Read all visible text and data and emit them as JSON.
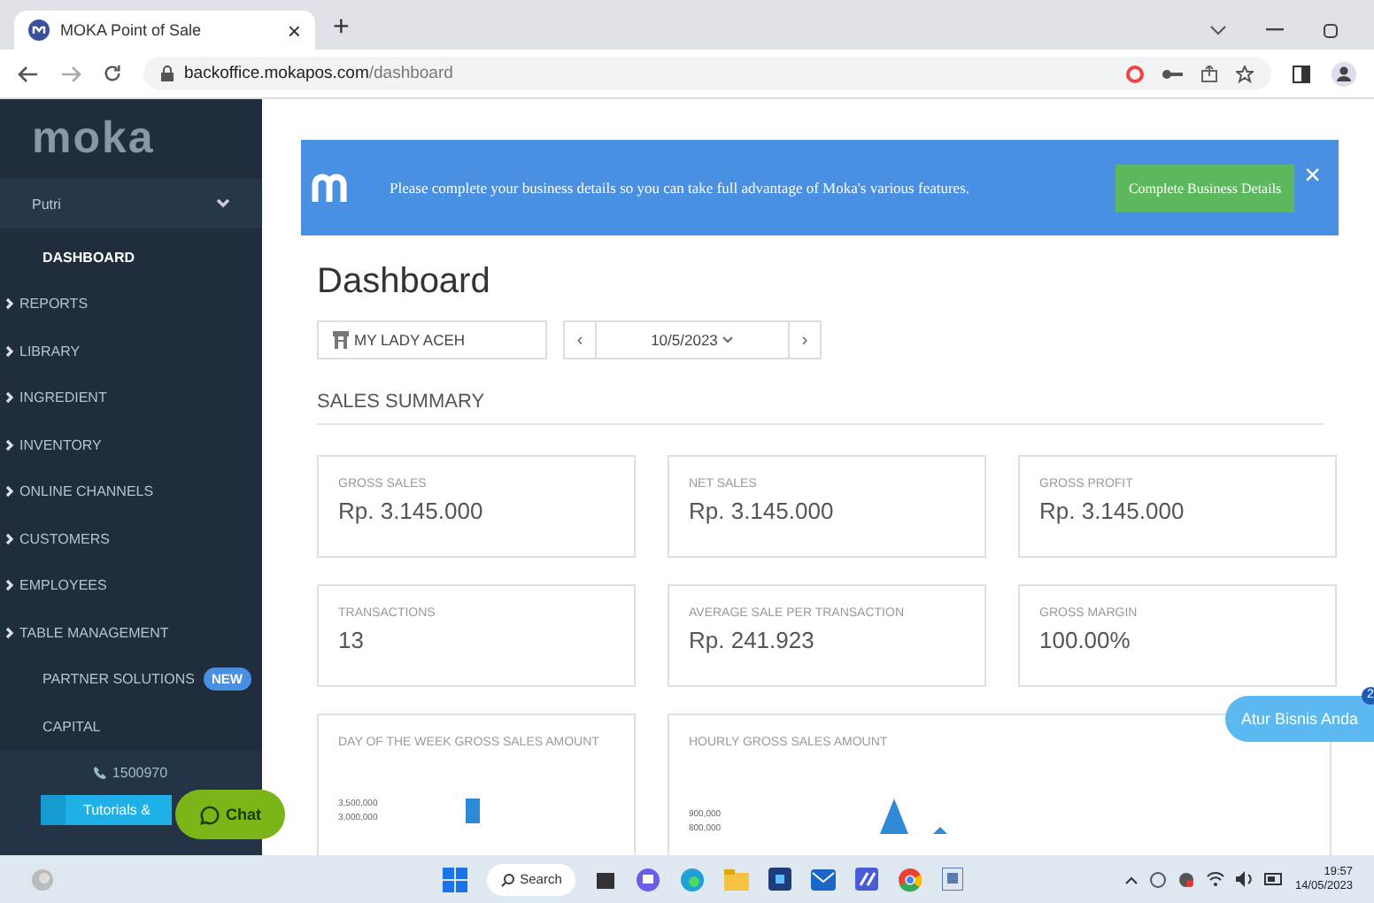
{
  "browser": {
    "tab_title": "MOKA Point of Sale",
    "tab_close": "×",
    "new_tab": "+",
    "url_host": "backoffice.mokapos.com",
    "url_path": "/dashboard"
  },
  "sidebar": {
    "logo": "moka",
    "user": "Putri",
    "items": [
      {
        "label": "DASHBOARD",
        "selected": true,
        "expandable": false
      },
      {
        "label": "REPORTS",
        "selected": false,
        "expandable": true
      },
      {
        "label": "LIBRARY",
        "selected": false,
        "expandable": true
      },
      {
        "label": "INGREDIENT",
        "selected": false,
        "expandable": true
      },
      {
        "label": "INVENTORY",
        "selected": false,
        "expandable": true
      },
      {
        "label": "ONLINE CHANNELS",
        "selected": false,
        "expandable": true
      },
      {
        "label": "CUSTOMERS",
        "selected": false,
        "expandable": true
      },
      {
        "label": "EMPLOYEES",
        "selected": false,
        "expandable": true
      },
      {
        "label": "TABLE MANAGEMENT",
        "selected": false,
        "expandable": true
      },
      {
        "label": "PARTNER SOLUTIONS",
        "selected": false,
        "expandable": false,
        "badge": "NEW"
      },
      {
        "label": "CAPITAL",
        "selected": false,
        "expandable": false
      }
    ],
    "phone": "1500970",
    "tutorials": "Tutorials &"
  },
  "chat_button": "Chat",
  "banner": {
    "message": "Please complete your business details so you can take full advantage of Moka's various features.",
    "button": "Complete Business Details",
    "close": "×"
  },
  "page_title": "Dashboard",
  "outlet": "MY LADY ACEH",
  "date": "10/5/2023",
  "prev": "‹",
  "next": "›",
  "section": "SALES SUMMARY",
  "cards": [
    {
      "label": "GROSS SALES",
      "value": "Rp. 3.145.000"
    },
    {
      "label": "NET SALES",
      "value": "Rp. 3.145.000"
    },
    {
      "label": "GROSS PROFIT",
      "value": "Rp. 3.145.000"
    },
    {
      "label": "TRANSACTIONS",
      "value": "13"
    },
    {
      "label": "AVERAGE SALE PER TRANSACTION",
      "value": "Rp. 241.923"
    },
    {
      "label": "GROSS MARGIN",
      "value": "100.00%"
    }
  ],
  "charts": [
    {
      "title": "DAY OF THE WEEK GROSS SALES AMOUNT",
      "ticks": [
        "3,500,000",
        "3,000,000"
      ],
      "kind": "bar"
    },
    {
      "title": "HOURLY GROSS SALES AMOUNT",
      "ticks": [
        "900,000",
        "800,000"
      ],
      "kind": "area"
    }
  ],
  "help_button": {
    "label": "Atur Bisnis Anda",
    "badge": "2"
  },
  "taskbar": {
    "search": "Search",
    "time": "19:57",
    "date": "14/05/2023"
  }
}
